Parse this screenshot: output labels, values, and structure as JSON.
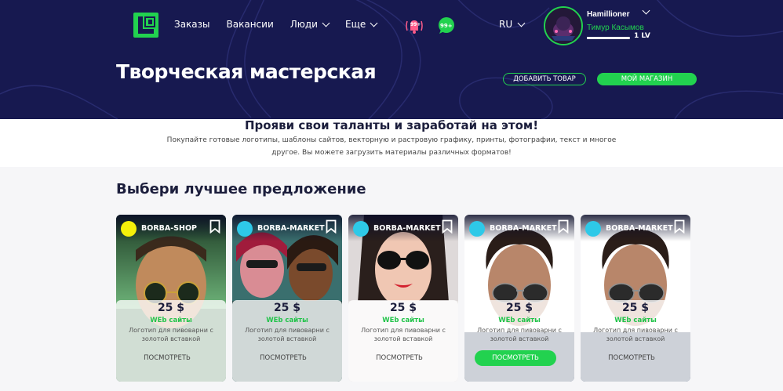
{
  "nav": {
    "items": [
      {
        "label": "Заказы",
        "dropdown": false
      },
      {
        "label": "Вакансии",
        "dropdown": false
      },
      {
        "label": "Люди",
        "dropdown": true
      },
      {
        "label": "Еще",
        "dropdown": true
      }
    ],
    "notifications_badge": "99+",
    "messages_badge": "99+",
    "language": "RU"
  },
  "user": {
    "username": "Hamillioner",
    "real_name": "Тимур Касымов",
    "level": "1 LV",
    "level_progress": 0.75
  },
  "header": {
    "title": "Творческая мастерская",
    "add_product_label": "ДОБАВИТЬ ТОВАР",
    "my_store_label": "МОЙ МАГАЗИН"
  },
  "intro": {
    "title": "Прояви свои таланты и заработай на этом!",
    "text": "Покупайте готовые логотипы, шаблоны сайтов, векторную и растровую графику, принты, фотографии, текст и многое другое. Вы можете загрузить материалы различных форматов!"
  },
  "offers": {
    "title": "Выбери лучшее предложение",
    "cards": [
      {
        "store": "BORBA-SHOP",
        "dot_color": "#f5f00a",
        "price": "25 $",
        "category": "WEb сайты",
        "description": "Логотип для пивоварни с золотой вставкой",
        "button": "ПОСМОТРЕТЬ",
        "active": false,
        "scene": "sunglasses-man-green"
      },
      {
        "store": "BORBA-MARKET",
        "dot_color": "#2ec9e8",
        "price": "25 $",
        "category": "WEb сайты",
        "description": "Логотип для пивоварни с золотой вставкой",
        "button": "ПОСМОТРЕТЬ",
        "active": false,
        "scene": "two-women-sunglasses"
      },
      {
        "store": "BORBA-MARKET",
        "dot_color": "#2ec9e8",
        "price": "25 $",
        "category": "WEb сайты",
        "description": "Логотип для пивоварни с золотой вставкой",
        "button": "ПОСМОТРЕТЬ",
        "active": false,
        "scene": "woman-sunglasses"
      },
      {
        "store": "BORBA-MARKET",
        "dot_color": "#2ec9e8",
        "price": "25 $",
        "category": "WEb сайты",
        "description": "Логотип для пивоварни с золотой вставкой",
        "button": "ПОСМОТРЕТЬ",
        "active": true,
        "scene": "man-aviators"
      },
      {
        "store": "BORBA-MARKET",
        "dot_color": "#2ec9e8",
        "price": "25 $",
        "category": "WEb сайты",
        "description": "Логотип для пивоварни с золотой вставкой",
        "button": "ПОСМОТРЕТЬ",
        "active": false,
        "scene": "man-aviators"
      }
    ]
  },
  "colors": {
    "header_bg": "#171950",
    "accent_green": "#22d24f",
    "notification_pink": "#ff5c8a"
  }
}
